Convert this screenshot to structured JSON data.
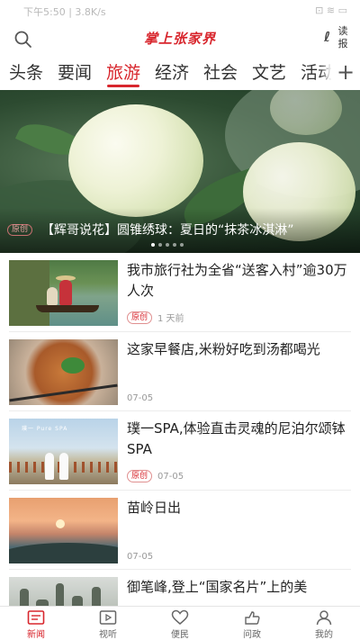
{
  "status_bar": {
    "left_text": "下午5:50 | 3.8K/s",
    "right_text": "⊡  ≋  ▭"
  },
  "header": {
    "app_title": "掌上张家界",
    "read_button_mark": "ℓ",
    "read_button_text": "读报"
  },
  "tabs": [
    {
      "label": "头条"
    },
    {
      "label": "要闻"
    },
    {
      "label": "旅游"
    },
    {
      "label": "经济"
    },
    {
      "label": "社会"
    },
    {
      "label": "文艺"
    },
    {
      "label": "活动"
    }
  ],
  "active_tab": "旅游",
  "more_tabs_symbol": "+",
  "hero": {
    "badge": "原创",
    "title": "【辉哥说花】圆锥绣球：夏日的“抹茶冰淇淋”",
    "slide_index": 1,
    "slide_count": 5
  },
  "news": [
    {
      "title": "我市旅行社为全省“送客入村”逾30万人次",
      "badge": "原创",
      "time": "1 天前",
      "thumb": "river-boat-image"
    },
    {
      "title": "这家早餐店,米粉好吃到汤都喝光",
      "badge": "",
      "time": "07-05",
      "thumb": "rice-noodle-image"
    },
    {
      "title": "璞一SPA,体验直击灵魂的尼泊尔颂钵SPA",
      "badge": "原创",
      "time": "07-05",
      "thumb": "spa-image",
      "thumb_text": "璞一 Pure SPA"
    },
    {
      "title": "苗岭日出",
      "badge": "",
      "time": "07-05",
      "thumb": "sunrise-image"
    },
    {
      "title": "御笔峰,登上“国家名片”上的美",
      "badge": "",
      "time": "",
      "thumb": "peaks-image"
    }
  ],
  "bottom_nav": [
    {
      "label": "新闻",
      "icon": "news-icon",
      "active": true
    },
    {
      "label": "视听",
      "icon": "video-icon",
      "active": false
    },
    {
      "label": "便民",
      "icon": "heart-icon",
      "active": false
    },
    {
      "label": "问政",
      "icon": "hand-icon",
      "active": false
    },
    {
      "label": "我的",
      "icon": "user-icon",
      "active": false
    }
  ],
  "colors": {
    "accent": "#d8262d",
    "text": "#222222",
    "muted": "#999999"
  }
}
